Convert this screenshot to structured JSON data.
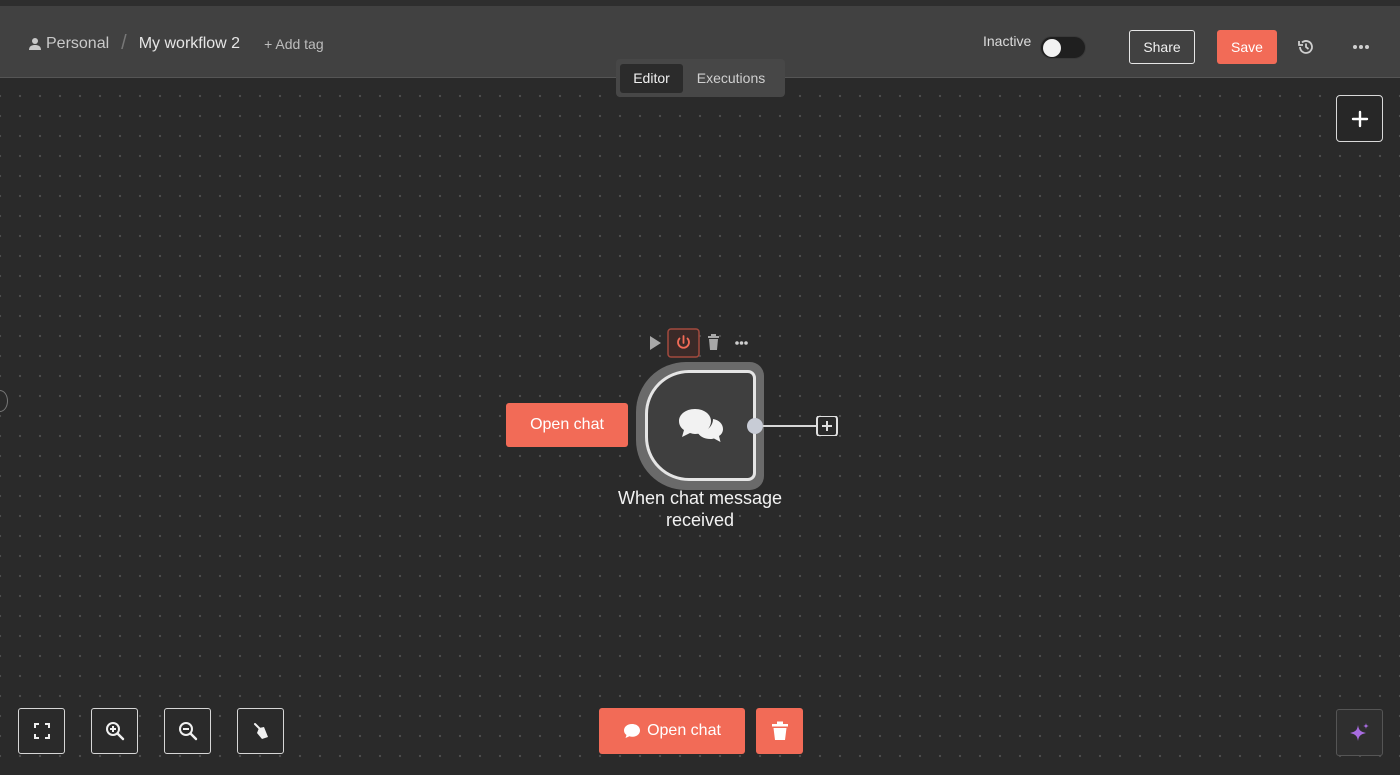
{
  "header": {
    "project": "Personal",
    "workflow_name": "My workflow 2",
    "add_tag": "+ Add tag",
    "status_label": "Inactive",
    "active": false,
    "share_label": "Share",
    "save_label": "Save"
  },
  "tabs": [
    {
      "label": "Editor",
      "active": true
    },
    {
      "label": "Executions",
      "active": false
    }
  ],
  "node": {
    "side_button_label": "Open chat",
    "title_line1": "When chat message",
    "title_line2": "received",
    "icon": "chat-bubbles-icon"
  },
  "bottom": {
    "open_chat_label": "Open chat"
  },
  "colors": {
    "accent": "#f26b57",
    "canvas": "#2a2a2a",
    "topbar": "#414141"
  }
}
